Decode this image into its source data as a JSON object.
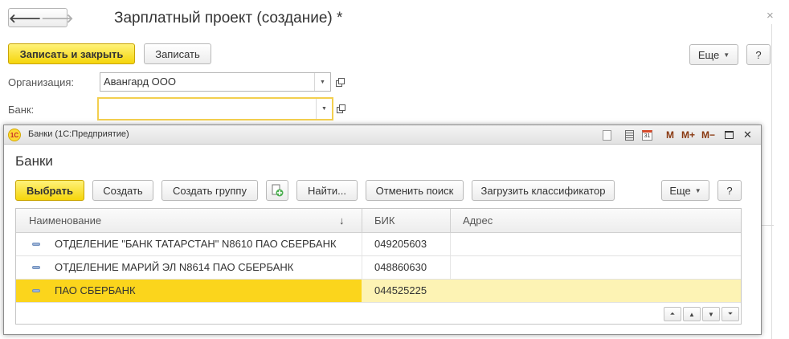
{
  "form": {
    "title": "Зарплатный проект (создание) *",
    "close": "×",
    "nav_back": "🡐",
    "nav_forward": "🡒",
    "save_close": "Записать и закрыть",
    "save": "Записать",
    "more": "Еще",
    "help": "?",
    "org_label": "Организация:",
    "org_value": "Авангард ООО",
    "bank_label": "Банк:",
    "bank_value": ""
  },
  "dialog": {
    "caption": "Банки  (1С:Предприятие)",
    "logo": "1С",
    "heading": "Банки",
    "toolbar": {
      "m": "M",
      "m_plus": "M+",
      "m_minus": "M−",
      "minimize": "—",
      "close": "✕",
      "calendar_day": "31"
    },
    "buttons": {
      "select": "Выбрать",
      "create": "Создать",
      "create_group": "Создать группу",
      "find": "Найти...",
      "cancel_search": "Отменить поиск",
      "load_classifier": "Загрузить классификатор",
      "more": "Еще",
      "help": "?"
    },
    "columns": {
      "name": "Наименование",
      "bik": "БИК",
      "address": "Адрес",
      "sort": "↓"
    },
    "rows": [
      {
        "name": "ОТДЕЛЕНИЕ \"БАНК ТАТАРСТАН\" N8610 ПАО СБЕРБАНК",
        "bik": "049205603",
        "address": ""
      },
      {
        "name": "ОТДЕЛЕНИЕ МАРИЙ ЭЛ N8614 ПАО СБЕРБАНК",
        "bik": "048860630",
        "address": ""
      },
      {
        "name": "ПАО СБЕРБАНК",
        "bik": "044525225",
        "address": ""
      }
    ],
    "scroll": {
      "top": "⏶",
      "up": "▲",
      "down": "▼",
      "bottom": "⏷"
    }
  },
  "colors": {
    "accent_yellow": "#f5d50a",
    "selected_row": "#fbd51c",
    "selected_row_light": "#fdf3b4",
    "focus_border": "#f3cf4e"
  },
  "icons": {
    "back": "arrow-left-icon",
    "forward": "arrow-right-icon",
    "open": "open-form-icon",
    "dropdown": "chevron-down-icon",
    "add_copy": "add-copy-icon",
    "row": "item-dash-icon"
  }
}
